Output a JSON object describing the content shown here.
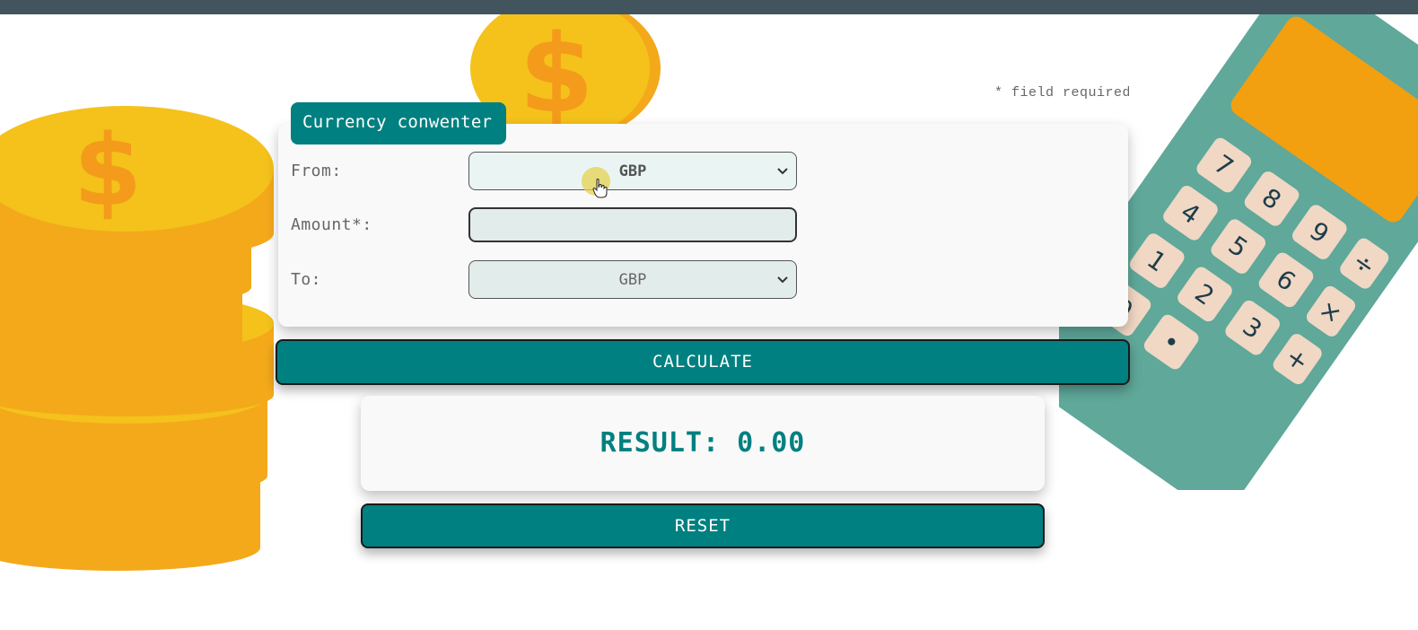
{
  "topbar": {},
  "note": {
    "required": "* field required"
  },
  "converter": {
    "title": "Currency conwenter",
    "from_label": "From:",
    "from_value": "GBP",
    "amount_label": "Amount*:",
    "amount_value": "",
    "to_label": "To:",
    "to_value": "GBP"
  },
  "actions": {
    "calculate": "CALCULATE",
    "reset": "RESET"
  },
  "result": {
    "text": "RESULT: 0.00"
  },
  "icons": {
    "coins": "coin-stack-icon",
    "coin": "dollar-coin-icon",
    "calculator": "calculator-icon",
    "chevron": "chevron-down-icon",
    "cursor": "hand-cursor-icon"
  },
  "colors": {
    "accent": "#008080",
    "topbar": "#42555f",
    "coin": "#f4c21b",
    "calculator": "#5fa89a"
  }
}
